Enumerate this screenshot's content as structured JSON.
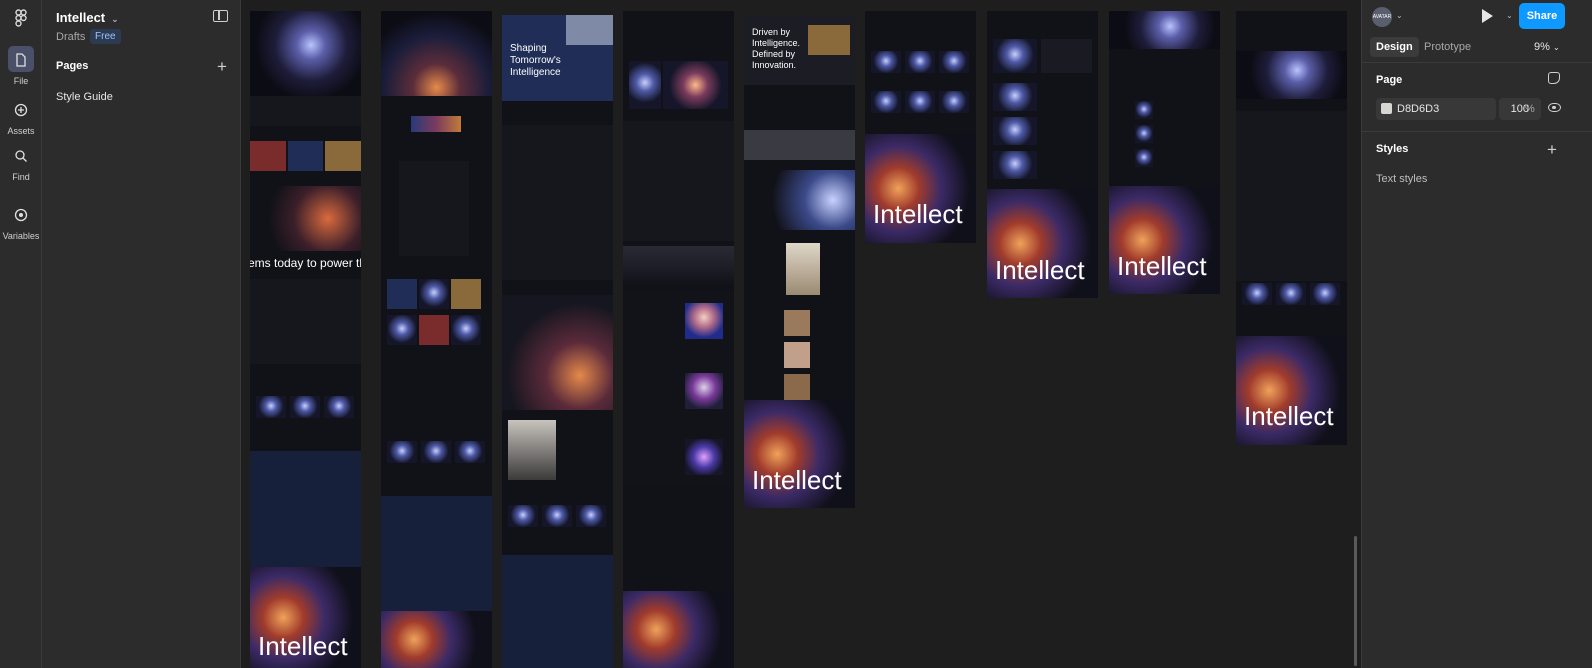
{
  "rail": {
    "file_label": "File",
    "assets_label": "Assets",
    "find_label": "Find",
    "variables_label": "Variables"
  },
  "file": {
    "name": "Intellect",
    "location": "Drafts",
    "plan_badge": "Free"
  },
  "pages": {
    "header": "Pages",
    "items": [
      "Style Guide"
    ]
  },
  "canvas": {
    "frame_texts": {
      "hero_shaping": "Shaping Tomorrow's Intelligence",
      "driven": "Driven by Intelligence. Defined by Innovation.",
      "marquee": "ems today to power the in",
      "wordmark": "Intellect"
    }
  },
  "right_panel": {
    "avatar_text": "AVATAR",
    "share_label": "Share",
    "tabs": [
      "Design",
      "Prototype"
    ],
    "zoom": "9%",
    "page_section": "Page",
    "page_color_hex": "D8D6D3",
    "page_opacity": "100",
    "percent_sign": "%",
    "styles_section": "Styles",
    "text_styles": "Text styles"
  },
  "colors": {
    "accent": "#0d99ff",
    "panel_bg": "#2c2c2c",
    "canvas_bg": "#1e1e1e",
    "page_fill": "#D8D6D3"
  }
}
